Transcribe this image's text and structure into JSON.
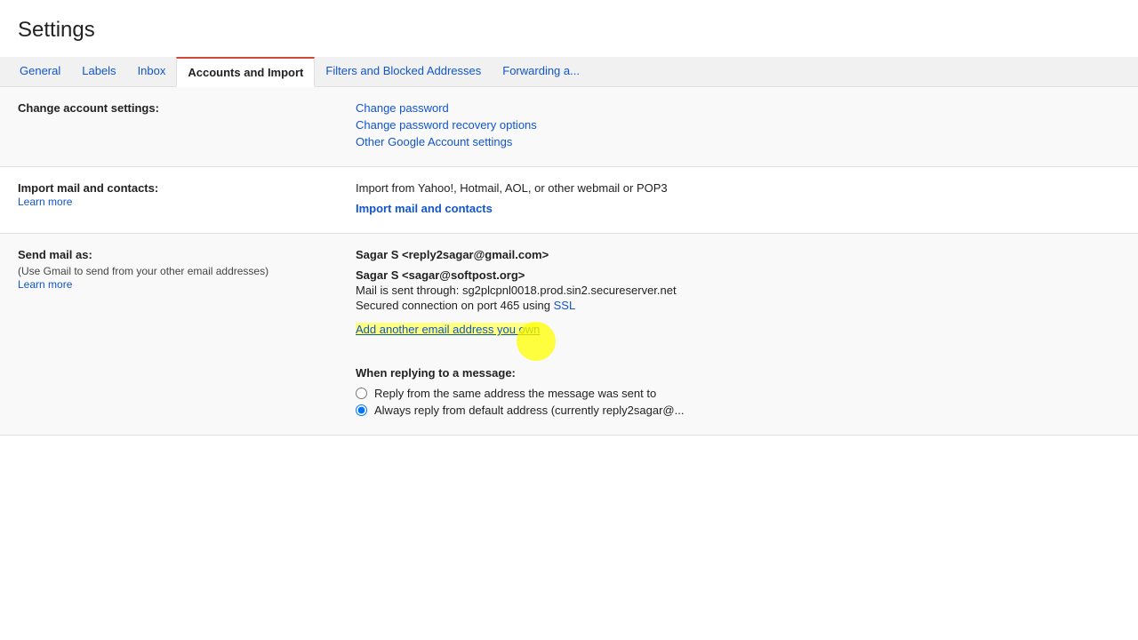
{
  "page": {
    "title": "Settings"
  },
  "tabs": [
    {
      "id": "general",
      "label": "General",
      "active": false
    },
    {
      "id": "labels",
      "label": "Labels",
      "active": false
    },
    {
      "id": "inbox",
      "label": "Inbox",
      "active": false
    },
    {
      "id": "accounts-and-import",
      "label": "Accounts and Import",
      "active": true
    },
    {
      "id": "filters-and-blocked",
      "label": "Filters and Blocked Addresses",
      "active": false
    },
    {
      "id": "forwarding",
      "label": "Forwarding a...",
      "active": false
    }
  ],
  "sections": [
    {
      "id": "change-account-settings",
      "label": "Change account settings:",
      "links": [
        {
          "id": "change-password",
          "text": "Change password"
        },
        {
          "id": "change-password-recovery",
          "text": "Change password recovery options"
        },
        {
          "id": "other-google-account",
          "text": "Other Google Account settings"
        }
      ]
    },
    {
      "id": "import-mail-contacts",
      "label": "Import mail and contacts:",
      "learn_more": "Learn more",
      "import_desc": "Import from Yahoo!, Hotmail, AOL, or other webmail or POP3",
      "import_link": "Import mail and contacts"
    },
    {
      "id": "send-mail-as",
      "label": "Send mail as:",
      "sublabel": "(Use Gmail to send from your other email addresses)",
      "learn_more": "Learn more",
      "primary_email": "Sagar S <reply2sagar@gmail.com>",
      "secondary_email": "Sagar S <sagar@softpost.org>",
      "mail_sent_through": "Mail is sent through: sg2plcpnl0018.prod.sin2.secureserver.net",
      "secured_connection": "Secured connection on port 465 using",
      "ssl_link": "SSL",
      "add_email_link": "Add another email address you own",
      "when_replying_label": "When replying to a message:",
      "reply_options": [
        {
          "id": "reply-same",
          "label": "Reply from the same address the message was sent to",
          "checked": false
        },
        {
          "id": "reply-default",
          "label": "Always reply from default address (currently reply2sagar@...",
          "checked": true
        }
      ]
    }
  ]
}
